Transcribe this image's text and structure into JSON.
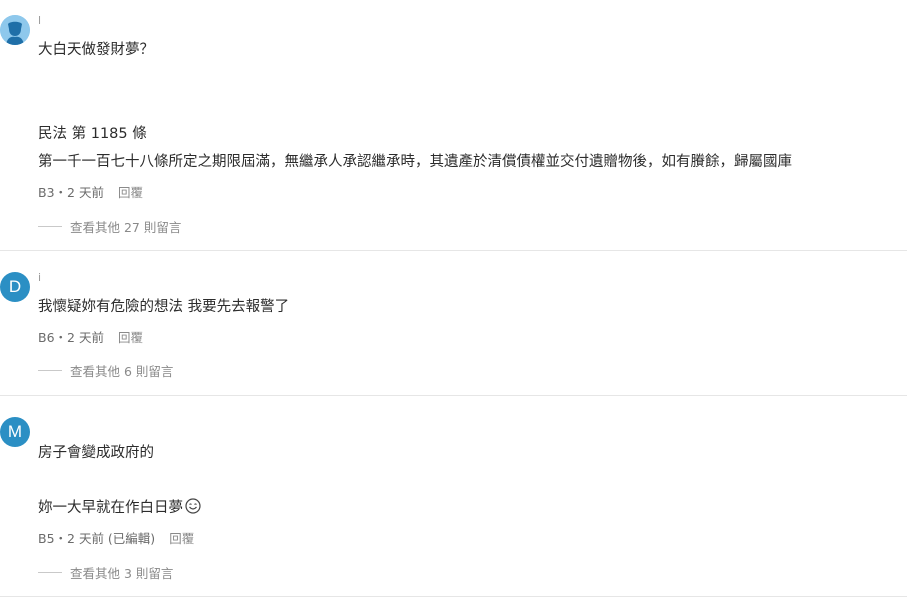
{
  "comments": [
    {
      "author": "l",
      "avatar_icon": "person-silhouette-icon",
      "lines": [
        "大白天做發財夢？",
        "",
        "",
        "民法 第 1185 條",
        "第一千一百七十八條所定之期限屆滿，無繼承人承認繼承時，其遺產於清償債權並交付遺贈物後，如有賸餘，歸屬國庫"
      ],
      "floor_time": "B3・2 天前",
      "reply_label": "回覆",
      "more_label": "查看其他 27 則留言"
    },
    {
      "author": "i",
      "avatar_letter": "D",
      "lines": [
        "我懷疑妳有危險的想法 我要先去報警了"
      ],
      "floor_time": "B6・2 天前",
      "reply_label": "回覆",
      "more_label": "查看其他 6 則留言"
    },
    {
      "author": "",
      "avatar_letter": "M",
      "lines": [
        "房子會變成政府的",
        "",
        "妳一大早就在作白日夢"
      ],
      "emoji_icon": "smiling-face-emoji-icon",
      "floor_time": "B5・2 天前 (已編輯)",
      "reply_label": "回覆",
      "more_label": "查看其他 3 則留言"
    }
  ],
  "colors": {
    "avatar_blue": "#2b8fc4",
    "avatar_light": "#8ec8ec",
    "divider": "#e6e6e6"
  }
}
